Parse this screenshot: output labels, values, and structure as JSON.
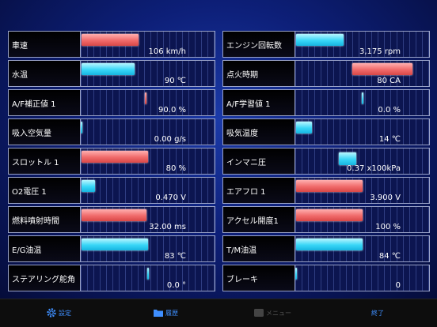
{
  "left": [
    {
      "label": "車速",
      "value": "106 km/h",
      "level": 0.43,
      "color": "red"
    },
    {
      "label": "水温",
      "value": "90 ℃",
      "level": 0.4,
      "color": "cyan"
    },
    {
      "label": "A/F補正値 1",
      "value": "90.0 %",
      "level": 0.48,
      "color": "red",
      "style": "thin"
    },
    {
      "label": "吸入空気量",
      "value": "0.00 g/s",
      "level": 0.0,
      "color": "cyan",
      "style": "thin"
    },
    {
      "label": "スロットル 1",
      "value": "80 %",
      "level": 0.5,
      "color": "red"
    },
    {
      "label": "O2電圧 1",
      "value": "0.470 V",
      "level": 0.1,
      "color": "cyan"
    },
    {
      "label": "燃料噴射時間",
      "value": "32.00 ms",
      "level": 0.49,
      "color": "red"
    },
    {
      "label": "E/G油温",
      "value": "83 ℃",
      "level": 0.5,
      "color": "cyan"
    },
    {
      "label": "ステアリング舵角",
      "value": "0.0 °",
      "level": 0.5,
      "color": "cyan",
      "style": "thin"
    }
  ],
  "right": [
    {
      "label": "エンジン回転数",
      "value": "3,175 rpm",
      "level": 0.36,
      "color": "cyan"
    },
    {
      "label": "点火時期",
      "value": "80 CA",
      "level": 0.45,
      "color": "red"
    },
    {
      "label": "A/F学習値 1",
      "value": "0.0 %",
      "level": 0.5,
      "color": "cyan",
      "style": "thin"
    },
    {
      "label": "吸気温度",
      "value": "14 ℃",
      "level": 0.12,
      "color": "cyan"
    },
    {
      "label": "インマニ圧",
      "value": "0.37 x100kPa",
      "level": 0.13,
      "color": "cyan"
    },
    {
      "label": "エアフロ 1",
      "value": "3.900 V",
      "level": 0.5,
      "color": "red"
    },
    {
      "label": "アクセル開度1",
      "value": "100 %",
      "level": 0.5,
      "color": "red"
    },
    {
      "label": "T/M油温",
      "value": "84 ℃",
      "level": 0.5,
      "color": "cyan"
    },
    {
      "label": "ブレーキ",
      "value": "0",
      "level": 0.0,
      "color": "cyan",
      "style": "thin"
    }
  ],
  "toolbar": {
    "settings_label": "設定",
    "history_label": "履歴",
    "menu_label": "メニュー",
    "exit_label": "終了"
  },
  "colors": {
    "accent": "#3f8fff",
    "red_bar": "#f06a6a",
    "cyan_bar": "#38d6f7",
    "panel_bg": "#0d1f78"
  }
}
